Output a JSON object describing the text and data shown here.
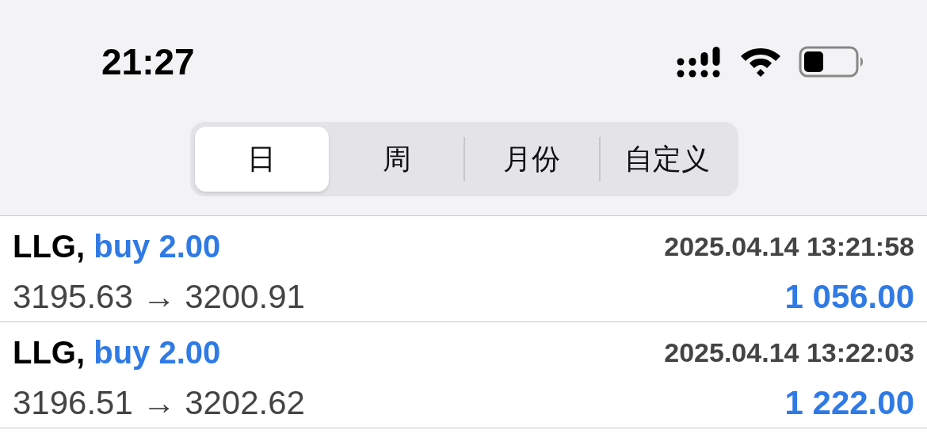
{
  "status_bar": {
    "time": "21:27"
  },
  "period_tabs": [
    {
      "label": "日",
      "selected": true
    },
    {
      "label": "周",
      "selected": false
    },
    {
      "label": "月份",
      "selected": false
    },
    {
      "label": "自定义",
      "selected": false
    }
  ],
  "trades": [
    {
      "symbol": "LLG,",
      "order": "buy 2.00",
      "time": "2025.04.14 13:21:58",
      "prices": "3195.63 → 3200.91",
      "profit": "1 056.00"
    },
    {
      "symbol": "LLG,",
      "order": "buy 2.00",
      "time": "2025.04.14 13:22:03",
      "prices": "3196.51 → 3202.62",
      "profit": "1 222.00"
    }
  ]
}
